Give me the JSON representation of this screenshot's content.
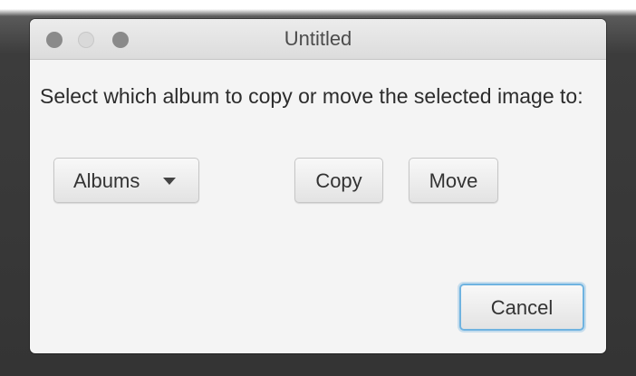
{
  "window": {
    "title": "Untitled"
  },
  "dialog": {
    "prompt": "Select which album to copy or move the selected image to:",
    "album_select": {
      "selected": "Albums"
    },
    "copy_label": "Copy",
    "move_label": "Move",
    "cancel_label": "Cancel"
  },
  "colors": {
    "focus_ring": "#6fb3e0",
    "window_bg": "#f4f4f4"
  }
}
